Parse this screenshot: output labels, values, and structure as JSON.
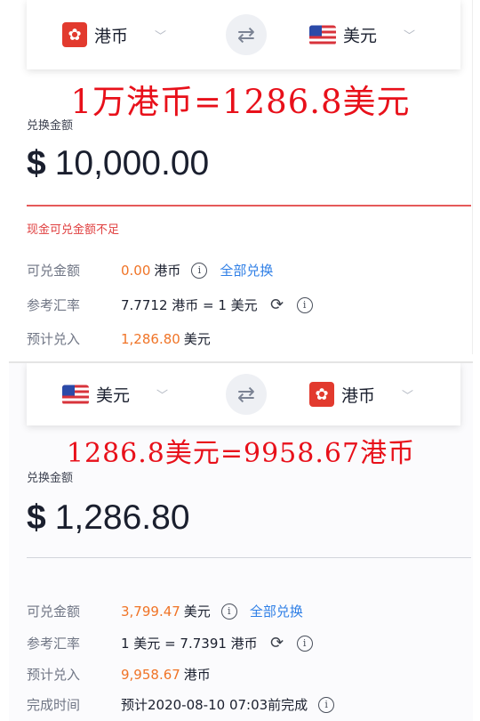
{
  "panel1": {
    "from_currency": {
      "name": "港币",
      "icon": "hk-flag-icon"
    },
    "to_currency": {
      "name": "美元",
      "icon": "us-flag-icon"
    },
    "annotation": "1万港币=1286.8美元",
    "amount_label": "兑换金额",
    "amount_symbol": "$",
    "amount_value": "10,000.00",
    "warning": "现金可兑金额不足",
    "available": {
      "label": "可兑金额",
      "value": "0.00",
      "unit": "港币",
      "link": "全部兑换"
    },
    "rate": {
      "label": "参考汇率",
      "value": "7.7712 港币 = 1 美元"
    },
    "estimate": {
      "label": "预计兑入",
      "value": "1,286.80",
      "unit": "美元"
    }
  },
  "panel2": {
    "from_currency": {
      "name": "美元",
      "icon": "us-flag-icon"
    },
    "to_currency": {
      "name": "港币",
      "icon": "hk-flag-icon"
    },
    "annotation": "1286.8美元=9958.67港币",
    "amount_label": "兑换金额",
    "amount_symbol": "$",
    "amount_value": "1,286.80",
    "available": {
      "label": "可兑金额",
      "value": "3,799.47",
      "unit": "美元",
      "link": "全部兑换"
    },
    "rate": {
      "label": "参考汇率",
      "value": "1 美元 = 7.7391 港币"
    },
    "estimate": {
      "label": "预计兑入",
      "value": "9,958.67",
      "unit": "港币"
    },
    "completion": {
      "label": "完成时间",
      "value": "预计2020-08-10 07:03前完成"
    }
  },
  "colors": {
    "accent_orange": "#f07427",
    "link_blue": "#2f7fe6",
    "warning_red": "#e04040",
    "annotation_red": "#e8101a"
  }
}
